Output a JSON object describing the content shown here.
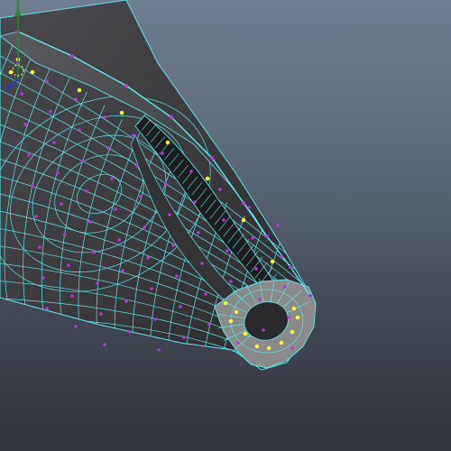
{
  "viewport": {
    "background_top": "#6f7f8f",
    "background_bottom": "#2f333a"
  },
  "mesh": {
    "face_color": "#3c3c3f",
    "face_highlight": "#55565a",
    "wire_color": "#62e4ec",
    "vertex_color": "#b23ad6",
    "selected_vertex_color": "#f4f43a",
    "selected_face_color": "#8a8a8a",
    "inner_fin_color": "#1c1c1e"
  },
  "gizmo": {
    "y_axis_color": "#1f8f2a",
    "z_axis_color": "#2b34c8",
    "pivot_color": "#e8e040",
    "icons": [
      "axis-gizmo-icon",
      "pivot-icon"
    ]
  }
}
